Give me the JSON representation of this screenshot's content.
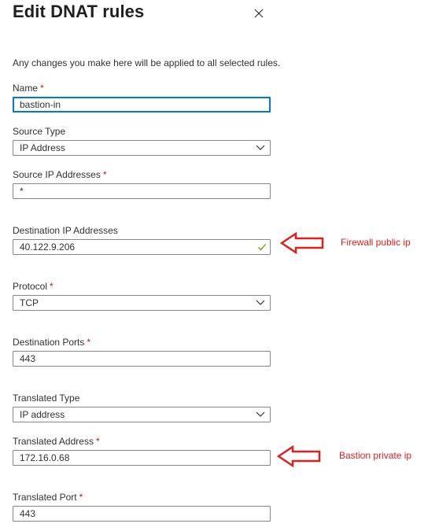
{
  "panel": {
    "title": "Edit DNAT rules",
    "intro": "Any changes you make here will be applied to all selected rules."
  },
  "fields": {
    "name": {
      "label": "Name",
      "required_mark": "*",
      "value": "bastion-in"
    },
    "source_type": {
      "label": "Source Type",
      "value": "IP Address"
    },
    "source_ip": {
      "label": "Source IP Addresses",
      "required_mark": "*",
      "value": "*"
    },
    "destination_ip": {
      "label": "Destination IP Addresses",
      "value": "40.122.9.206"
    },
    "protocol": {
      "label": "Protocol",
      "required_mark": "*",
      "value": "TCP"
    },
    "destination_ports": {
      "label": "Destination Ports",
      "required_mark": "*",
      "value": "443"
    },
    "translated_type": {
      "label": "Translated Type",
      "value": "IP address"
    },
    "translated_address": {
      "label": "Translated Address",
      "required_mark": "*",
      "value": "172.16.0.68"
    },
    "translated_port": {
      "label": "Translated Port",
      "required_mark": "*",
      "value": "443"
    }
  },
  "annotations": {
    "firewall": "Firewall public ip",
    "bastion": "Bastion private ip"
  },
  "icons": {
    "close": "close-icon",
    "dropdown": "chevron-down-icon",
    "valid": "checkmark-icon",
    "annotation": "arrow-left-icon"
  },
  "colors": {
    "accent": "#0078d4",
    "required": "#a4262c",
    "valid": "#57a300",
    "annotation": "#e02020",
    "border": "#8a8886"
  }
}
